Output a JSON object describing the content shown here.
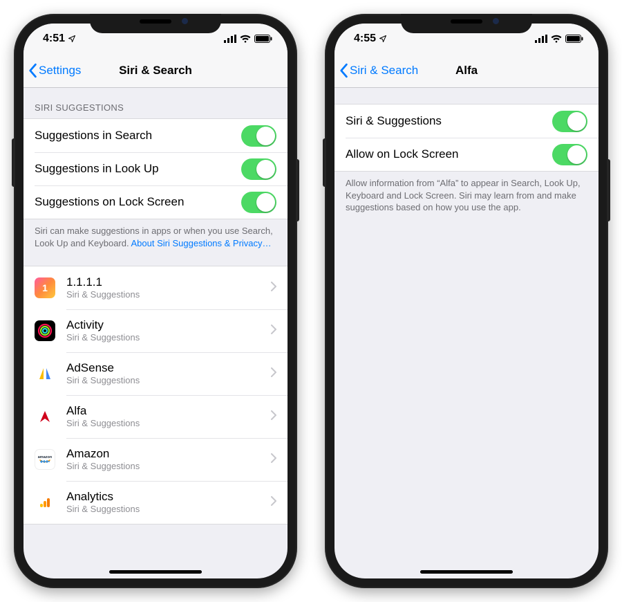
{
  "left": {
    "status_time": "4:51",
    "nav_back": "Settings",
    "nav_title": "Siri & Search",
    "section_header": "SIRI SUGGESTIONS",
    "toggles": [
      {
        "label": "Suggestions in Search",
        "on": true
      },
      {
        "label": "Suggestions in Look Up",
        "on": true
      },
      {
        "label": "Suggestions on Lock Screen",
        "on": true
      }
    ],
    "footer_text": "Siri can make suggestions in apps or when you use Search, Look Up and Keyboard. ",
    "footer_link": "About Siri Suggestions & Privacy…",
    "apps": [
      {
        "name": "1.1.1.1",
        "sub": "Siri & Suggestions",
        "icon": "1111"
      },
      {
        "name": "Activity",
        "sub": "Siri & Suggestions",
        "icon": "activity"
      },
      {
        "name": "AdSense",
        "sub": "Siri & Suggestions",
        "icon": "adsense"
      },
      {
        "name": "Alfa",
        "sub": "Siri & Suggestions",
        "icon": "alfa"
      },
      {
        "name": "Amazon",
        "sub": "Siri & Suggestions",
        "icon": "amazon"
      },
      {
        "name": "Analytics",
        "sub": "Siri & Suggestions",
        "icon": "analytics"
      }
    ]
  },
  "right": {
    "status_time": "4:55",
    "nav_back": "Siri & Search",
    "nav_title": "Alfa",
    "toggles": [
      {
        "label": "Siri & Suggestions",
        "on": true
      },
      {
        "label": "Allow on Lock Screen",
        "on": true
      }
    ],
    "footer_text": "Allow information from “Alfa” to appear in Search, Look Up, Keyboard and Lock Screen. Siri may learn from and make suggestions based on how you use the app."
  }
}
